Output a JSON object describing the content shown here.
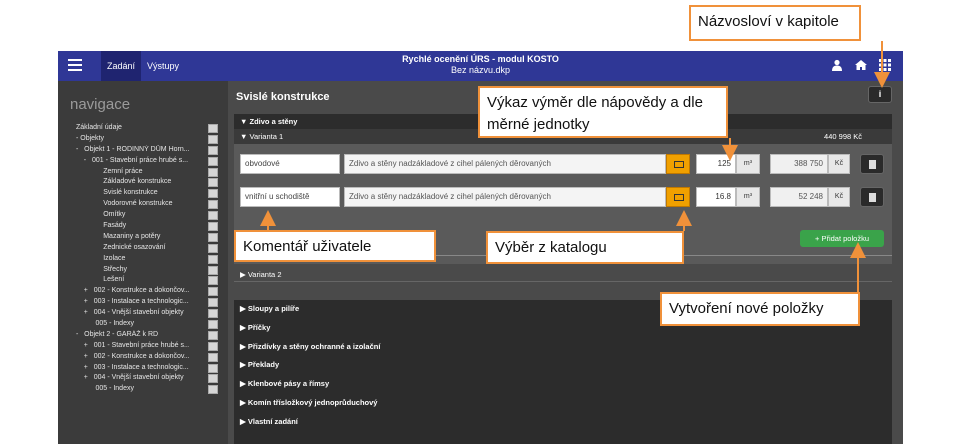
{
  "topbar": {
    "tabs": [
      "Zadání",
      "Výstupy"
    ],
    "title": "Rychlé ocenění ÚRS - modul KOSTO",
    "subtitle": "Bez názvu.dkp",
    "icons": [
      "user-icon",
      "home-icon",
      "grid-icon"
    ]
  },
  "sidebar": {
    "title": "navigace",
    "items": [
      {
        "label": "Základní údaje"
      },
      {
        "label": "- Objekty"
      },
      {
        "label": "-   Objekt 1 - RODINNÝ DŮM Horn..."
      },
      {
        "label": "    -   001 - Stavební práce hrubé s..."
      },
      {
        "label": "              Zemní práce"
      },
      {
        "label": "              Základové konstrukce"
      },
      {
        "label": "              Svislé konstrukce"
      },
      {
        "label": "              Vodorovné konstrukce"
      },
      {
        "label": "              Omítky"
      },
      {
        "label": "              Fasády"
      },
      {
        "label": "              Mazaniny a potěry"
      },
      {
        "label": "              Zednické osazování"
      },
      {
        "label": "              Izolace"
      },
      {
        "label": "              Střechy"
      },
      {
        "label": "              Lešení"
      },
      {
        "label": "    +   002 - Konstrukce a dokončov..."
      },
      {
        "label": "    +   003 - Instalace a technologic..."
      },
      {
        "label": "    +   004 - Vnější stavební objekty"
      },
      {
        "label": "          005 - Indexy"
      },
      {
        "label": "-   Objekt 2 - GARÁŽ k RD"
      },
      {
        "label": "    +   001 - Stavební práce hrubé s..."
      },
      {
        "label": "    +   002 - Konstrukce a dokončov..."
      },
      {
        "label": "    +   003 - Instalace a technologic..."
      },
      {
        "label": "    +   004 - Vnější stavební objekty"
      },
      {
        "label": "          005 - Indexy"
      }
    ]
  },
  "main": {
    "title": "Svislé konstrukce",
    "group_label": "▼ Zdivo a stěny",
    "variant1_label": "▼ Varianta 1",
    "variant1_price": "440 998 Kč",
    "rows": [
      {
        "comment": "obvodové",
        "desc": "Zdivo a stěny nadzákladové z cihel pálených děrovaných",
        "qty": "125",
        "unit": "m³",
        "price": "388 750",
        "currency": "Kč"
      },
      {
        "comment": "vnitřní u schodiště",
        "desc": "Zdivo a stěny nadzákladové z cihel pálených děrovaných",
        "qty": "16.8",
        "unit": "m³",
        "price": "52 248",
        "currency": "Kč"
      }
    ],
    "add_label": "+ Přidat položku",
    "variant2_label": "▶ Varianta 2",
    "other_sections": [
      "▶ Sloupy a pilíře",
      "▶ Příčky",
      "▶ Přizdívky a stěny ochranné a izolační",
      "▶ Překlady",
      "▶ Klenbové pásy a římsy",
      "▶ Komín třísložkový jednoprůduchový",
      "▶ Vlastní zadání"
    ]
  },
  "callouts": {
    "nazvoslovi": "Názvosloví v kapitole",
    "vykaz": "Výkaz výměr dle nápovědy a dle měrné jednotky",
    "komentar": "Komentář uživatele",
    "vyber": "Výběr z katalogu",
    "nova": "Vytvoření nové položky"
  },
  "colors": {
    "topbar": "#2f3796",
    "accent_orange": "#f0913a",
    "catalog_button": "#f0a000",
    "add_button": "#3aa34a"
  }
}
